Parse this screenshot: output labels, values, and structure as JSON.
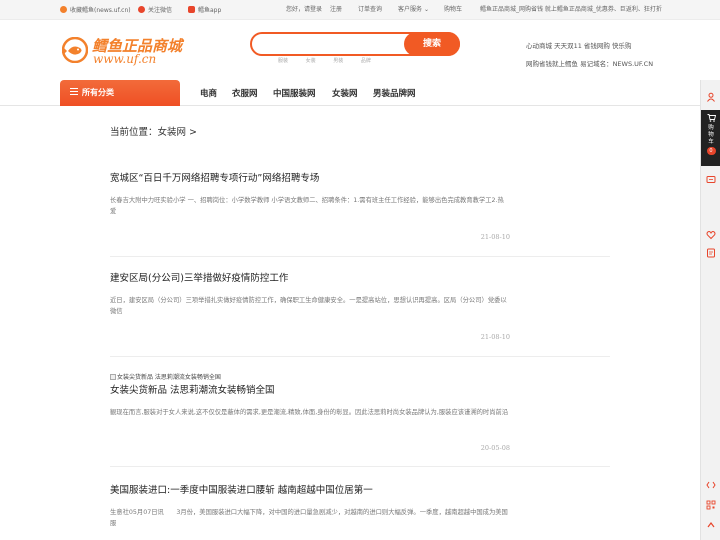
{
  "topbar": {
    "bookmark": "收藏鳕鱼(news.uf.cn)",
    "wechat": "关注微信",
    "app": "鳕鱼app",
    "greeting": "您好，请登录",
    "register": "注册",
    "orders": "订单查询",
    "service": "客户服务",
    "cart": "购物车",
    "site_title": "鳕鱼正品商城_网购省钱 就上鳕鱼正品商城_优惠券、巨返利、狂打折"
  },
  "header": {
    "logo_cn": "鳕鱼正品商城",
    "logo_en": "www.uf.cn",
    "search_placeholder": "",
    "search_button": "搜索",
    "hot_words": [
      "服装",
      "女装",
      "男装",
      "品牌"
    ],
    "slogan_line1": "心动商城 天天双11 省钱网购 快乐购",
    "slogan_line2": "网购省钱就上鳕鱼 易记域名：NEWS.UF.CN"
  },
  "nav": {
    "all_categories": "所有分类",
    "links": [
      "电商",
      "衣服网",
      "中国服装网",
      "女装网",
      "男装品牌网"
    ]
  },
  "sidebar": {
    "cart_label": "购物车",
    "cart_count": "0"
  },
  "breadcrumb": "当前位置：女装网 >",
  "articles": [
    {
      "title": "宽城区“百日千万网络招聘专项行动”网络招聘专场",
      "summary": "长春吉大附中力旺实验小学 一、招聘岗位：小学数学教师 小学语文教师二、招聘条件：1.需有班主任工作经验，能够出色完成教育教学工2.热爱",
      "date": "21-08-10"
    },
    {
      "title": "建安区局(分公司)三举措做好疫情防控工作",
      "summary": "近日，建安区局（分公司）三项举措扎实做好疫情防控工作，确保职工生命健康安全。一是提高站位，思想认识再提高。区局（分公司）党委以微信",
      "date": "21-08-10"
    },
    {
      "image_alt": "女装尖货新品 法思莉潮流女装畅销全国",
      "title": "女装尖货新品 法思莉潮流女装畅销全国",
      "summary": "観现在而言,服装对于女人来说,这不仅仅是蔽体的需求,更是潮流,精致,体面,身份的彰显。因此法思莉时尚女装品牌认为,服装应该谨溯的时尚前沿",
      "date": "20-05-08"
    },
    {
      "title": "美国服装进口:一季度中国服装进口腰斩 越南超越中国位居第一",
      "summary": "生意社05月07日讯　　3月份，美国服装进口大幅下降，对中国的进口量急剧减少，对越南的进口则大幅反弹。一季度，越南超越中国成为美国服",
      "date": ""
    }
  ],
  "colors": {
    "accent": "#f15a24",
    "logo": "#f3812c"
  }
}
